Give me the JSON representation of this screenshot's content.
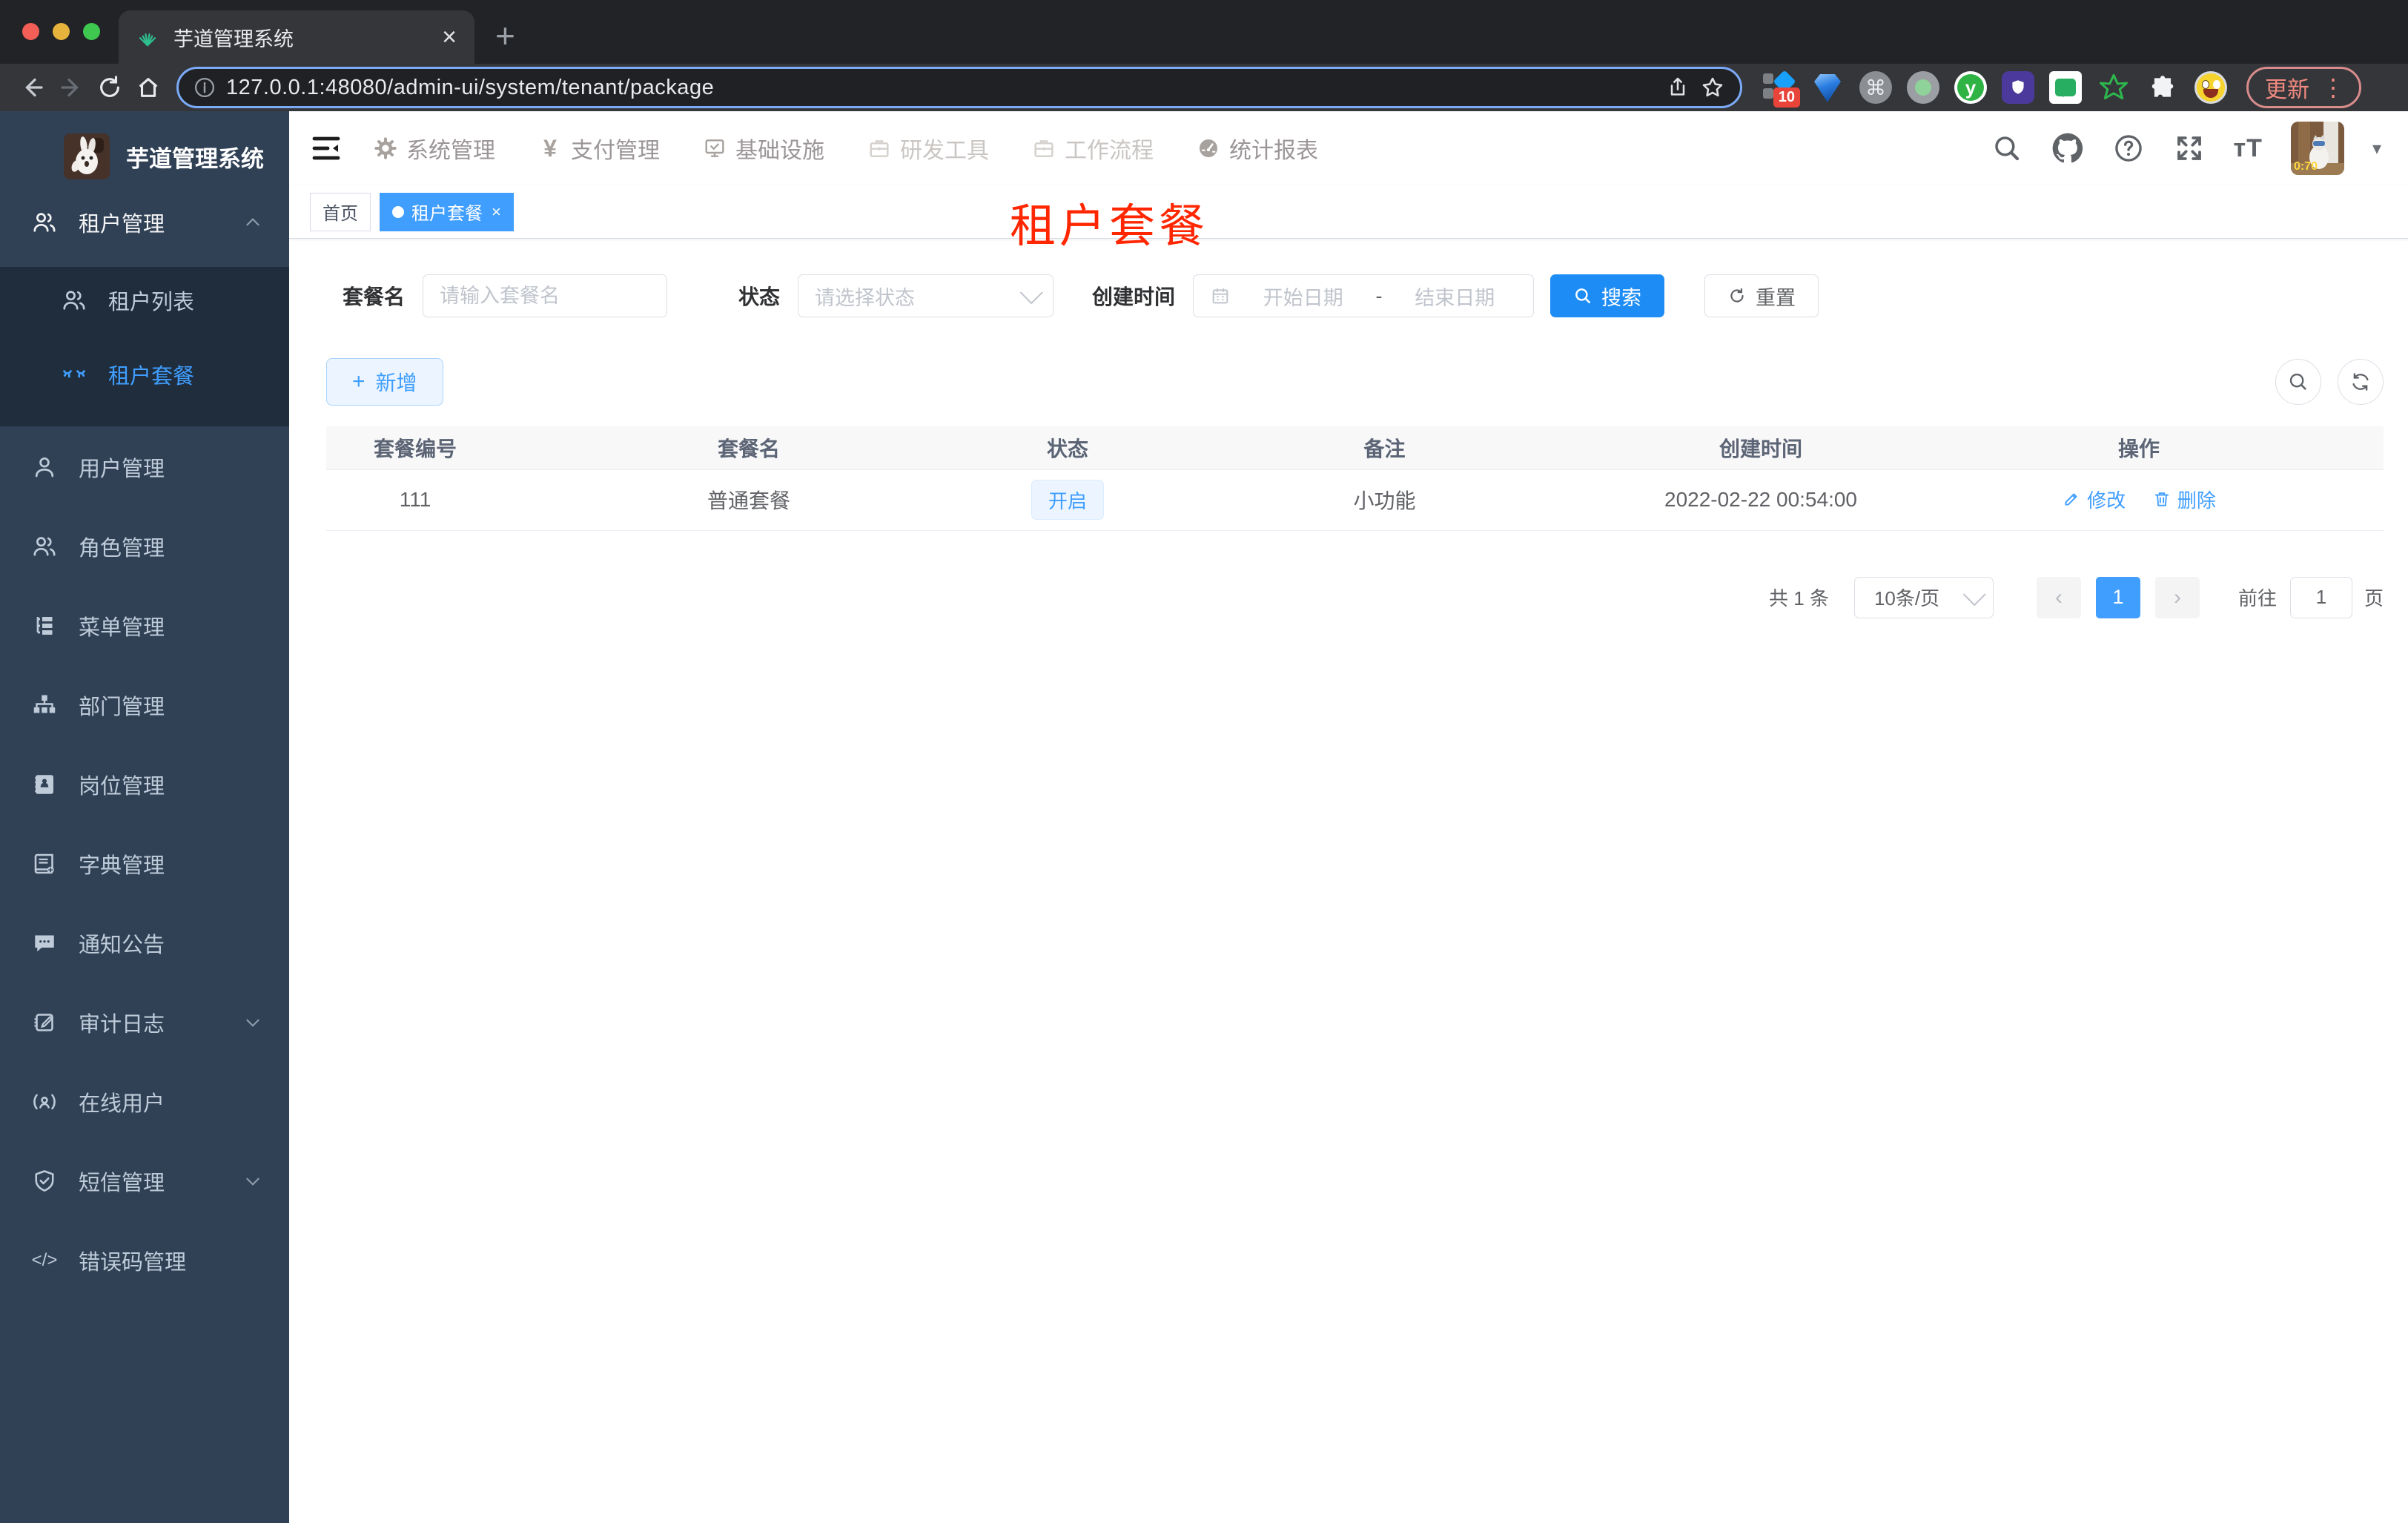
{
  "browser": {
    "tab_title": "芋道管理系统",
    "url": "127.0.0.1:48080/admin-ui/system/tenant/package",
    "extension_badge": "10",
    "update_label": "更新",
    "glyphs": {
      "close": "×",
      "new_tab": "+",
      "cmd": "⌘",
      "menu_dots": "⋮",
      "y_badge": "y"
    }
  },
  "app_header": {
    "nav": [
      {
        "label": "系统管理"
      },
      {
        "label": "支付管理"
      },
      {
        "label": "基础设施"
      },
      {
        "label": "研发工具"
      },
      {
        "label": "工作流程"
      },
      {
        "label": "统计报表"
      }
    ],
    "glyphs": {
      "yen": "¥",
      "question": "?",
      "font_size": "тT",
      "caret": "▾"
    },
    "avatar_timer": "0:70"
  },
  "sidebar": {
    "title": "芋道管理系统",
    "items": [
      {
        "label": "租户管理"
      },
      {
        "label": "租户列表"
      },
      {
        "label": "租户套餐"
      },
      {
        "label": "用户管理"
      },
      {
        "label": "角色管理"
      },
      {
        "label": "菜单管理"
      },
      {
        "label": "部门管理"
      },
      {
        "label": "岗位管理"
      },
      {
        "label": "字典管理"
      },
      {
        "label": "通知公告"
      },
      {
        "label": "审计日志"
      },
      {
        "label": "在线用户"
      },
      {
        "label": "短信管理"
      },
      {
        "label": "错误码管理"
      }
    ],
    "code_glyph": "</>"
  },
  "tags": {
    "home": "首页",
    "active": "租户套餐",
    "close": "×"
  },
  "overlay_title": "租户套餐",
  "filters": {
    "name_label": "套餐名",
    "name_placeholder": "请输入套餐名",
    "status_label": "状态",
    "status_placeholder": "请选择状态",
    "date_label": "创建时间",
    "date_start": "开始日期",
    "date_separator": "-",
    "date_end": "结束日期",
    "search_label": "搜索",
    "reset_label": "重置"
  },
  "toolbar": {
    "add_label": "新增",
    "plus": "+"
  },
  "table": {
    "headers": [
      "套餐编号",
      "套餐名",
      "状态",
      "备注",
      "创建时间",
      "操作"
    ],
    "rows": [
      {
        "id": "111",
        "name": "普通套餐",
        "status": "开启",
        "remark": "小功能",
        "created": "2022-02-22 00:54:00"
      }
    ],
    "actions": {
      "edit": "修改",
      "delete": "删除"
    }
  },
  "pagination": {
    "total": "共 1 条",
    "page_size": "10条/页",
    "prev": "‹",
    "current": "1",
    "next": "›",
    "goto_label": "前往",
    "goto_value": "1",
    "unit": "页"
  },
  "colors": {
    "primary": "#409EFF",
    "annotation_red": "#FF2600",
    "sidebar_bg": "#304156",
    "submenu_bg": "#1F2D3D"
  }
}
